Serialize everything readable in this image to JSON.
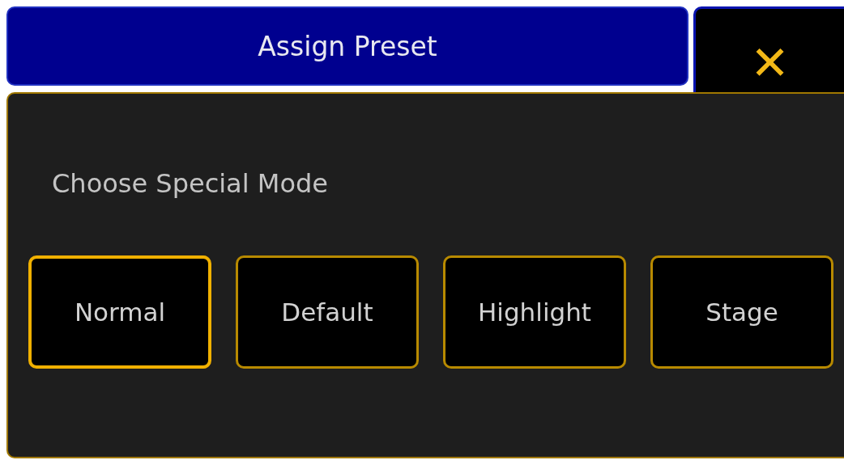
{
  "window": {
    "title": "Assign Preset",
    "close": "✕"
  },
  "prompt": "Choose Special Mode",
  "modes": [
    {
      "label": "Normal",
      "selected": true
    },
    {
      "label": "Default",
      "selected": false
    },
    {
      "label": "Highlight",
      "selected": false
    },
    {
      "label": "Stage",
      "selected": false
    }
  ]
}
